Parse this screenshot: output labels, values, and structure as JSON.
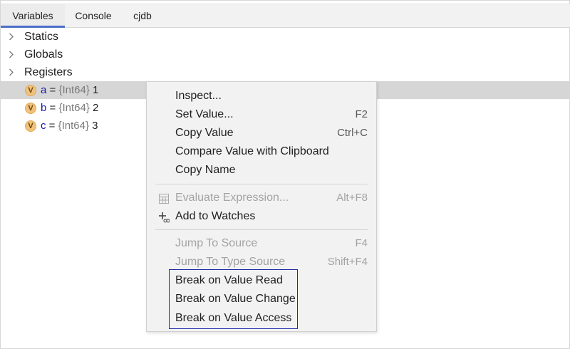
{
  "tabs": [
    {
      "label": "Variables",
      "active": true
    },
    {
      "label": "Console",
      "active": false
    },
    {
      "label": "cjdb",
      "active": false
    }
  ],
  "tree": {
    "groups": [
      {
        "label": "Statics"
      },
      {
        "label": "Globals"
      },
      {
        "label": "Registers"
      }
    ],
    "variables": [
      {
        "badge": "V",
        "name": "a",
        "eq": " = ",
        "type": "{Int64}",
        "value": " 1",
        "selected": true
      },
      {
        "badge": "V",
        "name": "b",
        "eq": " = ",
        "type": "{Int64}",
        "value": " 2",
        "selected": false
      },
      {
        "badge": "V",
        "name": "c",
        "eq": " = ",
        "type": "{Int64}",
        "value": " 3",
        "selected": false
      }
    ]
  },
  "context_menu": {
    "items": [
      {
        "label": "Inspect...",
        "shortcut": "",
        "enabled": true
      },
      {
        "label": "Set Value...",
        "shortcut": "F2",
        "enabled": true
      },
      {
        "label": "Copy Value",
        "shortcut": "Ctrl+C",
        "enabled": true
      },
      {
        "label": "Compare Value with Clipboard",
        "shortcut": "",
        "enabled": true
      },
      {
        "label": "Copy Name",
        "shortcut": "",
        "enabled": true
      },
      {
        "label": "Evaluate Expression...",
        "shortcut": "Alt+F8",
        "enabled": false,
        "icon": "calculator-icon"
      },
      {
        "label": "Add to Watches",
        "shortcut": "",
        "enabled": true,
        "icon": "add-watch-icon"
      },
      {
        "label": "Jump To Source",
        "shortcut": "F4",
        "enabled": false
      },
      {
        "label": "Jump To Type Source",
        "shortcut": "Shift+F4",
        "enabled": false
      },
      {
        "label": "Break on Value Read",
        "shortcut": "",
        "enabled": true
      },
      {
        "label": "Break on Value Change",
        "shortcut": "",
        "enabled": true
      },
      {
        "label": "Break on Value Access",
        "shortcut": "",
        "enabled": true
      }
    ]
  },
  "colors": {
    "accent": "#4a6fc7",
    "highlight_box": "#1e2aa6",
    "badge": "#f1c27d",
    "var_name": "#1a1aa6"
  }
}
